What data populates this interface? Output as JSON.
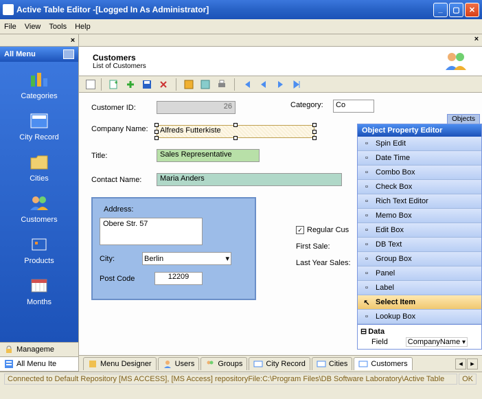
{
  "window": {
    "title": "Active Table Editor -[Logged In As Administrator]"
  },
  "menu": {
    "file": "File",
    "view": "View",
    "tools": "Tools",
    "help": "Help"
  },
  "sidebar": {
    "header": "All Menu",
    "items": [
      {
        "label": "Categories"
      },
      {
        "label": "City Record"
      },
      {
        "label": "Cities"
      },
      {
        "label": "Customers"
      },
      {
        "label": "Products"
      },
      {
        "label": "Months"
      }
    ],
    "tabs": [
      {
        "label": "Manageme"
      },
      {
        "label": "All Menu Ite"
      }
    ]
  },
  "header": {
    "title": "Customers",
    "subtitle": "List of Customers"
  },
  "form": {
    "customer_id_label": "Customer ID:",
    "customer_id_value": "26",
    "category_label": "Category:",
    "category_value": "Co",
    "company_label": "Company Name:",
    "company_value": "Alfreds Futterkiste",
    "title_label": "Title:",
    "title_value": "Sales Representative",
    "contact_label": "Contact Name:",
    "contact_value": "Maria Anders",
    "address": {
      "legend": "Address:",
      "street": "Obere Str. 57",
      "city_label": "City:",
      "city_value": "Berlin",
      "post_label": "Post Code",
      "post_value": "12209"
    },
    "right": {
      "regular": "Regular Cus",
      "first_sale": "First Sale:",
      "last_year": "Last Year Sales:"
    }
  },
  "objects": {
    "tab": "Objects",
    "header": "Object Property Editor",
    "items": [
      "Spin Edit",
      "Date Time",
      "Combo Box",
      "Check Box",
      "Rich Text Editor",
      "Memo Box",
      "Edit Box",
      "DB Text",
      "Group Box",
      "Panel",
      "Label",
      "Select Item",
      "Lookup Box"
    ],
    "selected_index": 11,
    "data_label": "Data",
    "field_label": "Field",
    "field_value": "CompanyName"
  },
  "tabs": [
    "Menu Designer",
    "Users",
    "Groups",
    "City Record",
    "Cities",
    "Customers"
  ],
  "status": {
    "msg": "Connected to Default Repository [MS ACCESS], [MS Access] repositoryFile:C:\\Program Files\\DB Software Laboratory\\Active Table",
    "ok": "OK"
  }
}
